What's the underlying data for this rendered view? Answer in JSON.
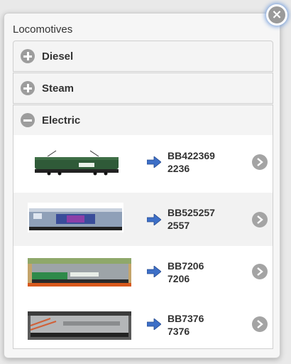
{
  "popup": {
    "title": "Locomotives",
    "close_icon": "close-icon"
  },
  "sections": [
    {
      "label": "Diesel",
      "state": "collapsed",
      "icon": "plus-icon"
    },
    {
      "label": "Steam",
      "state": "collapsed",
      "icon": "plus-icon"
    },
    {
      "label": "Electric",
      "state": "expanded",
      "icon": "minus-icon"
    }
  ],
  "electric": {
    "items": [
      {
        "name": "BB422369",
        "number": "2236",
        "icon": "arrow-right-icon",
        "detail_icon": "chevron-right-icon"
      },
      {
        "name": "BB525257",
        "number": "2557",
        "icon": "arrow-right-icon",
        "detail_icon": "chevron-right-icon"
      },
      {
        "name": "BB7206",
        "number": "7206",
        "icon": "arrow-right-icon",
        "detail_icon": "chevron-right-icon"
      },
      {
        "name": "BB7376",
        "number": "7376",
        "icon": "arrow-right-icon",
        "detail_icon": "chevron-right-icon"
      }
    ]
  },
  "colors": {
    "arrow": "#3d6fc7",
    "icon_grey": "#9d9d9d"
  }
}
